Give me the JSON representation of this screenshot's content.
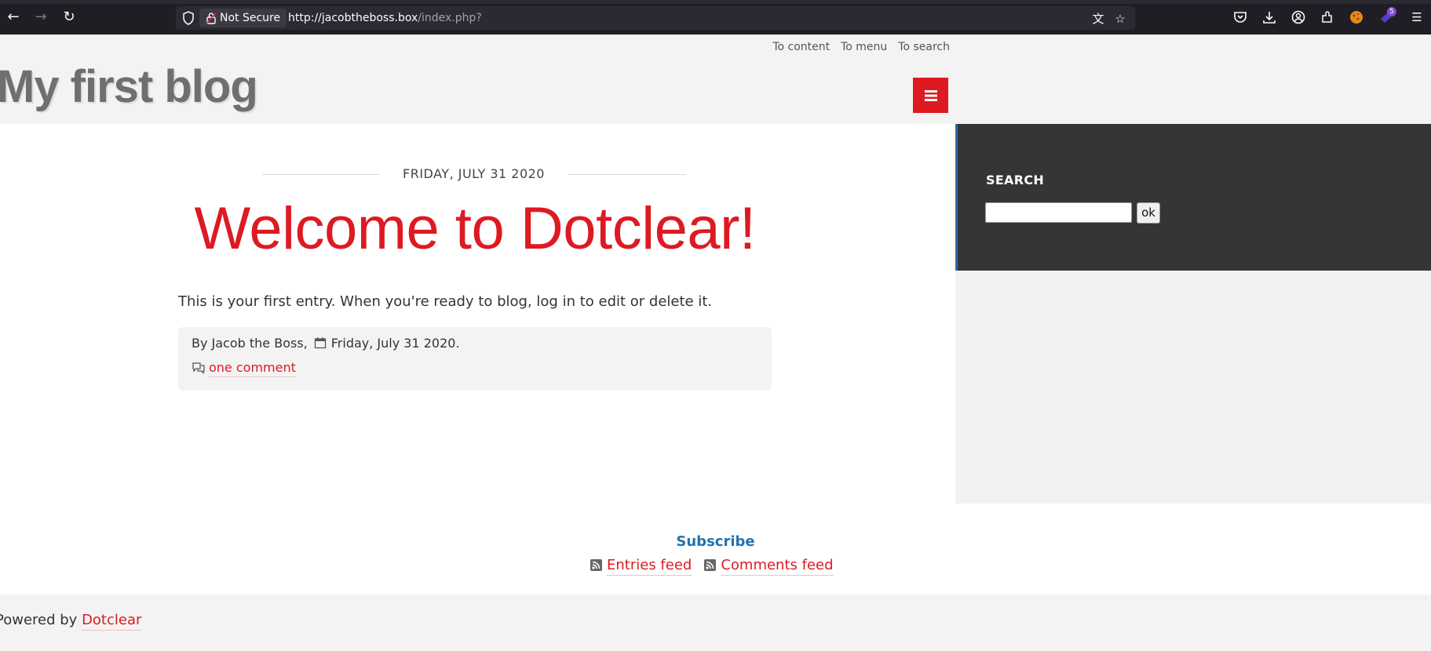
{
  "browser": {
    "security_label": "Not Secure",
    "url_host": "http://jacobtheboss.box",
    "url_path": "/index.php?",
    "extension_badge": "5"
  },
  "header": {
    "skip_links": [
      "To content",
      "To menu",
      "To search"
    ],
    "blog_title": "My first blog"
  },
  "post": {
    "date": "FRIDAY, JULY 31 2020",
    "title": "Welcome to Dotclear!",
    "body": "This is your first entry. When you're ready to blog, log in to edit or delete it.",
    "author": "By Jacob the Boss,",
    "meta_date": "Friday, July 31 2020.",
    "comments_link": "one comment"
  },
  "sidebar": {
    "search_title": "SEARCH",
    "search_value": "",
    "search_button": "ok"
  },
  "footer": {
    "subscribe_title": "Subscribe",
    "entries_feed": "Entries feed",
    "comments_feed": "Comments feed",
    "powered_by": "Powered by",
    "powered_link": "Dotclear"
  },
  "colors": {
    "accent_red": "#dd1a22",
    "subscribe_blue": "#2073b0",
    "sidebar_dark": "#333537"
  }
}
